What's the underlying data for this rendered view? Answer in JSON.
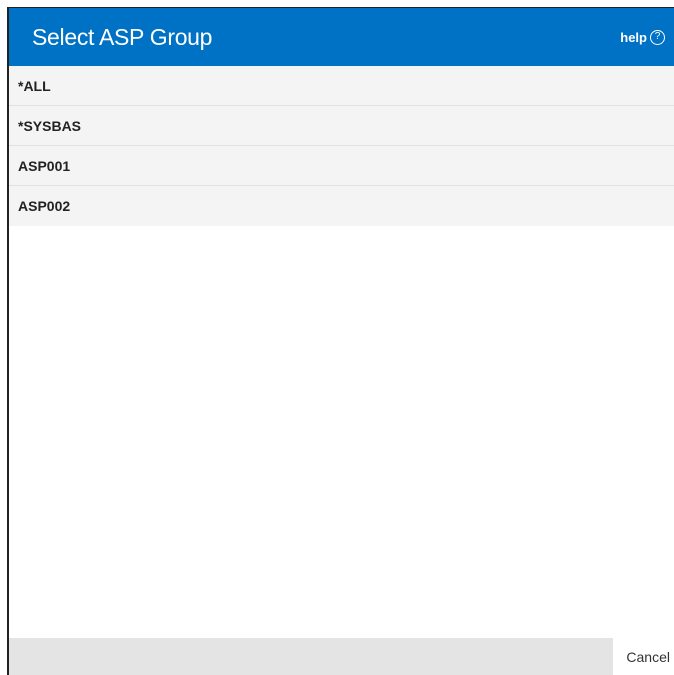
{
  "dialog": {
    "title": "Select ASP Group",
    "help_label": "help",
    "help_icon": "question-circle-icon",
    "header_color": "#0072c6"
  },
  "items": [
    {
      "label": "*ALL"
    },
    {
      "label": "*SYSBAS"
    },
    {
      "label": "ASP001"
    },
    {
      "label": "ASP002"
    }
  ],
  "footer": {
    "cancel_label": "Cancel"
  }
}
